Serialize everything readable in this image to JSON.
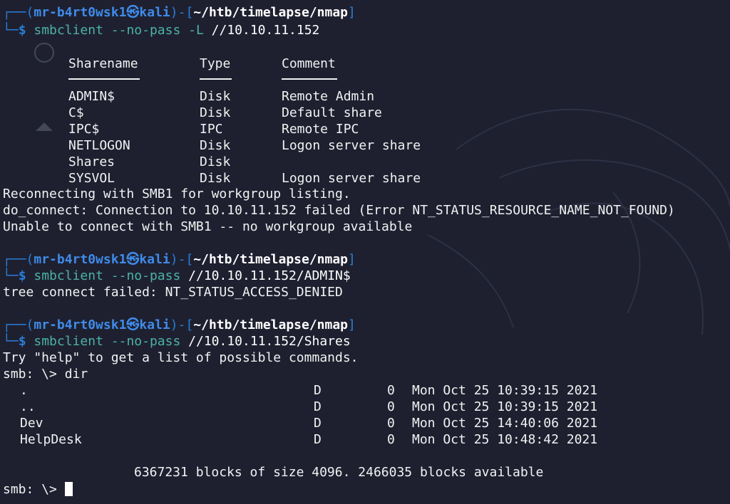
{
  "prompts": [
    {
      "user": "mr-b4rt0wsk1",
      "at_glyph": "㉿",
      "host": "kali",
      "path": "~/htb/timelapse/nmap",
      "cmd": "smbclient",
      "opts": "--no-pass -L",
      "arg": "//10.10.11.152"
    },
    {
      "user": "mr-b4rt0wsk1",
      "at_glyph": "㉿",
      "host": "kali",
      "path": "~/htb/timelapse/nmap",
      "cmd": "smbclient",
      "opts": "--no-pass",
      "arg": "//10.10.11.152/ADMIN$"
    },
    {
      "user": "mr-b4rt0wsk1",
      "at_glyph": "㉿",
      "host": "kali",
      "path": "~/htb/timelapse/nmap",
      "cmd": "smbclient",
      "opts": "--no-pass",
      "arg": "//10.10.11.152/Shares"
    }
  ],
  "share_table": {
    "headers": [
      "Sharename",
      "Type",
      "Comment"
    ],
    "rows": [
      [
        "ADMIN$",
        "Disk",
        "Remote Admin"
      ],
      [
        "C$",
        "Disk",
        "Default share"
      ],
      [
        "IPC$",
        "IPC",
        "Remote IPC"
      ],
      [
        "NETLOGON",
        "Disk",
        "Logon server share"
      ],
      [
        "Shares",
        "Disk",
        ""
      ],
      [
        "SYSVOL",
        "Disk",
        "Logon server share"
      ]
    ]
  },
  "output_1": [
    "Reconnecting with SMB1 for workgroup listing.",
    "do_connect: Connection to 10.10.11.152 failed (Error NT_STATUS_RESOURCE_NAME_NOT_FOUND)",
    "Unable to connect with SMB1 -- no workgroup available"
  ],
  "output_2": "tree connect failed: NT_STATUS_ACCESS_DENIED",
  "output_3": "Try \"help\" to get a list of possible commands.",
  "smb_prompt": "smb: \\>",
  "smb_command": "dir",
  "dir_listing": [
    {
      "name": ".",
      "attr": "D",
      "size": "0",
      "date": "Mon Oct 25 10:39:15 2021"
    },
    {
      "name": "..",
      "attr": "D",
      "size": "0",
      "date": "Mon Oct 25 10:39:15 2021"
    },
    {
      "name": "Dev",
      "attr": "D",
      "size": "0",
      "date": "Mon Oct 25 14:40:06 2021"
    },
    {
      "name": "HelpDesk",
      "attr": "D",
      "size": "0",
      "date": "Mon Oct 25 10:48:42 2021"
    }
  ],
  "blocks_summary": "6367231 blocks of size 4096. 2466035 blocks available",
  "final_prompt": "smb: \\>",
  "desktop_icons": [
    "disc-icon",
    "home-icon"
  ],
  "colors": {
    "background": "#1e2030",
    "prompt_blue": "#2a7dd6",
    "command_teal": "#4cb2a5",
    "text": "#f2f2f2"
  }
}
